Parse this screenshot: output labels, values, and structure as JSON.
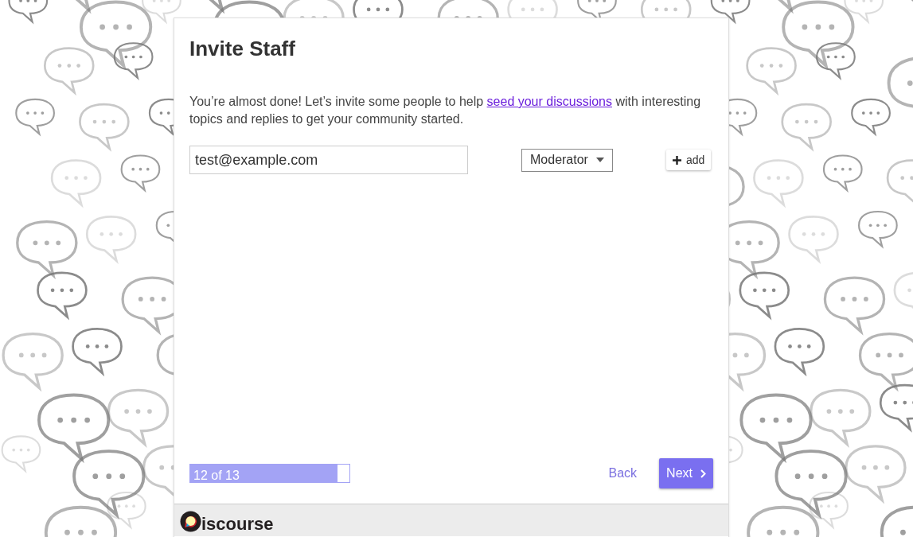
{
  "wizard": {
    "title": "Invite Staff",
    "description_start": "You’re almost done! Let’s invite some people to help ",
    "description_link": "seed your discussions",
    "description_end": " with interesting topics and replies to get your community started.",
    "invite": {
      "email": "test@example.com",
      "role": "Moderator",
      "add_label": "add"
    },
    "progress": {
      "label": "12 of 13",
      "level": 0.923
    },
    "back_label": "Back",
    "next_label": "Next"
  },
  "footer": {
    "logo_text": "iscourse"
  }
}
